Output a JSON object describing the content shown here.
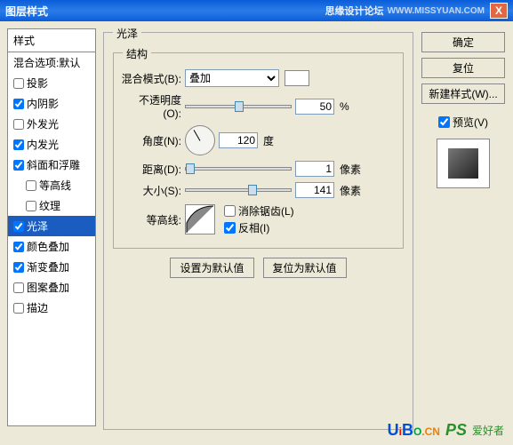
{
  "titlebar": {
    "title": "图层样式",
    "brand": "思缘设计论坛",
    "url": "WWW.MISSYUAN.COM",
    "close": "X"
  },
  "left": {
    "header": "样式",
    "items": [
      {
        "label": "混合选项:默认",
        "checkbox": false
      },
      {
        "label": "投影",
        "checked": false
      },
      {
        "label": "内阴影",
        "checked": true
      },
      {
        "label": "外发光",
        "checked": false
      },
      {
        "label": "内发光",
        "checked": true
      },
      {
        "label": "斜面和浮雕",
        "checked": true
      },
      {
        "label": "等高线",
        "checked": false,
        "indent": true
      },
      {
        "label": "纹理",
        "checked": false,
        "indent": true
      },
      {
        "label": "光泽",
        "checked": true,
        "selected": true
      },
      {
        "label": "颜色叠加",
        "checked": true
      },
      {
        "label": "渐变叠加",
        "checked": true
      },
      {
        "label": "图案叠加",
        "checked": false
      },
      {
        "label": "描边",
        "checked": false
      }
    ]
  },
  "center": {
    "group_title": "光泽",
    "struct_title": "结构",
    "blend_label": "混合模式(B):",
    "blend_value": "叠加",
    "opacity_label": "不透明度(O):",
    "opacity_value": "50",
    "opacity_unit": "%",
    "angle_label": "角度(N):",
    "angle_value": "120",
    "angle_unit": "度",
    "distance_label": "距离(D):",
    "distance_value": "1",
    "distance_unit": "像素",
    "size_label": "大小(S):",
    "size_value": "141",
    "size_unit": "像素",
    "contour_label": "等高线:",
    "antialias_label": "消除锯齿(L)",
    "antialias_checked": false,
    "invert_label": "反相(I)",
    "invert_checked": true,
    "btn_default": "设置为默认值",
    "btn_reset": "复位为默认值"
  },
  "right": {
    "ok": "确定",
    "cancel": "复位",
    "newstyle": "新建样式(W)...",
    "preview_label": "预览(V)",
    "preview_checked": true
  },
  "watermark": {
    "uibo": "UiBO",
    "cn": ".CN",
    "ps": "PS",
    "text": "爱好者"
  }
}
